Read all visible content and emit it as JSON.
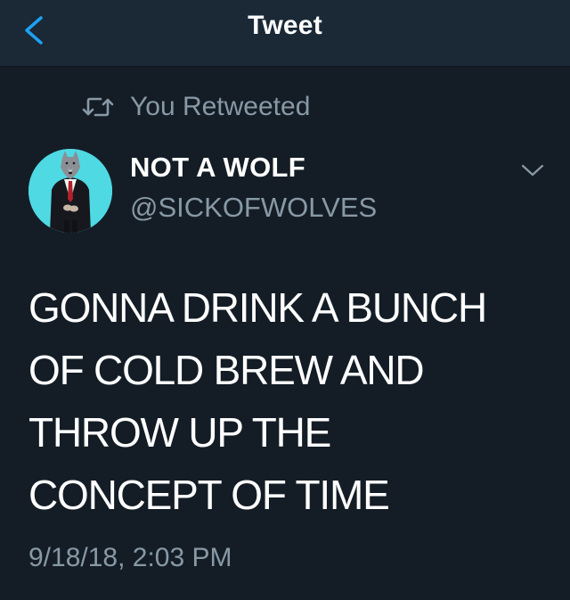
{
  "header": {
    "title": "Tweet",
    "back_icon": "chevron-left-icon",
    "accent_color": "#1da1f2"
  },
  "retweet": {
    "icon": "retweet-icon",
    "label": "You Retweeted"
  },
  "tweet": {
    "author_name": "NOT A WOLF",
    "author_handle": "@SICKOFWOLVES",
    "avatar": "wolf-in-suit-avatar",
    "menu_icon": "chevron-down-icon",
    "text_lines": [
      "GONNA DRINK A BUNCH",
      "OF COLD BREW AND",
      "THROW UP THE",
      "CONCEPT OF TIME"
    ],
    "timestamp": "9/18/18, 2:03 PM"
  },
  "colors": {
    "background": "#141d26",
    "header_background": "#1b2836",
    "secondary_text": "#8899a6",
    "avatar_background": "#4fd9e3"
  }
}
